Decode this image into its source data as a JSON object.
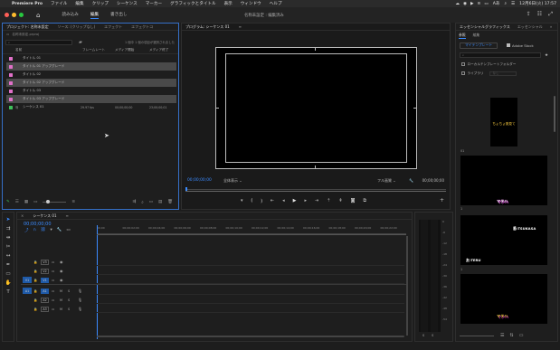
{
  "menubar": {
    "app_name": "Premiere Pro",
    "items": [
      "ファイル",
      "編集",
      "クリップ",
      "シーケンス",
      "マーカー",
      "グラフィックとタイトル",
      "表示",
      "ウィンドウ",
      "ヘルプ"
    ],
    "input_mode": "Aあ",
    "datetime": "12月6日(火) 17:57"
  },
  "toolbar": {
    "workspaces": [
      "読み込み",
      "編集",
      "書き出し"
    ],
    "document_title": "名称未設定 : 編集済み"
  },
  "project_panel": {
    "tabs": [
      "プロジェクト: 名称未設定",
      "ソース: (クリップなし)",
      "エフェクト",
      "エフェクトコ"
    ],
    "path": "名称未設定.prproj",
    "selection_note": "1 個中 1 個の項目が選択されました",
    "columns": [
      "名前",
      "フレームレート",
      "メディア開始",
      "メディア終了"
    ],
    "rows": [
      {
        "name": "タイトル 01",
        "fps": "",
        "start": "",
        "end": "",
        "color": "#e070c8",
        "selected": false
      },
      {
        "name": "タイトル 01 アップグレード",
        "fps": "",
        "start": "",
        "end": "",
        "color": "#e070c8",
        "selected": true
      },
      {
        "name": "タイトル 02",
        "fps": "",
        "start": "",
        "end": "",
        "color": "#e070c8",
        "selected": false
      },
      {
        "name": "タイトル 02 アップグレード",
        "fps": "",
        "start": "",
        "end": "",
        "color": "#e070c8",
        "selected": true
      },
      {
        "name": "タイトル 03",
        "fps": "",
        "start": "",
        "end": "",
        "color": "#e070c8",
        "selected": false
      },
      {
        "name": "タイトル 03 アップグレード",
        "fps": "",
        "start": "",
        "end": "",
        "color": "#e070c8",
        "selected": true
      },
      {
        "name": "シーケンス 01",
        "fps": "29.97 fps",
        "start": "00;00;00;00",
        "end": "23;00;00;01",
        "color": "#3ec05a",
        "selected": false
      }
    ]
  },
  "program_monitor": {
    "title": "プログラム: シーケンス 01",
    "timecode_current": "00;00;00;00",
    "fit": "全体表示",
    "quality": "フル画質",
    "timecode_duration": "00;00;00;00"
  },
  "timeline": {
    "tab": "シーケンス 01",
    "timecode": "00;00;00;00",
    "ruler": [
      "00;00",
      "00;00;02;00",
      "00;00;04;00",
      "00;00;06;00",
      "00;00;08;00",
      "00;00;10;00",
      "00;00;12;00",
      "00;00;14;00",
      "00;00;16;00",
      "00;00;18;00",
      "00;00;20;00",
      "00;00;22;00"
    ],
    "video_tracks": [
      "V3",
      "V2",
      "V1"
    ],
    "audio_tracks": [
      "A1",
      "A2",
      "A3"
    ],
    "src_video": "V1",
    "src_audio": "A1",
    "ms": "M",
    "ss": "S"
  },
  "audio_meter": {
    "scale": [
      "0",
      "-6",
      "-12",
      "-18",
      "-24",
      "-30",
      "-36",
      "-42",
      "-48",
      "-54"
    ],
    "s_labels": [
      "S",
      "S"
    ]
  },
  "essential_graphics": {
    "tabs": [
      "エッセンシャルグラフィックス",
      "エッセンシャル"
    ],
    "subtabs": [
      "参照",
      "編集"
    ],
    "template_dropdown": "マイテンプレート",
    "adobe_stock": "Adobe Stock",
    "local_folder": "ローカルテンプレートフォルダー",
    "library": "ライブラリ",
    "library_value": "なし",
    "thumbs": [
      {
        "text": "ちょちょ発見て",
        "label": "01"
      },
      {
        "text": "マテハ",
        "label": "1"
      },
      {
        "text": "番:TSUKASA",
        "text2": "友:TERU",
        "label": "1"
      },
      {
        "text": "マテハ",
        "label": ""
      }
    ]
  }
}
